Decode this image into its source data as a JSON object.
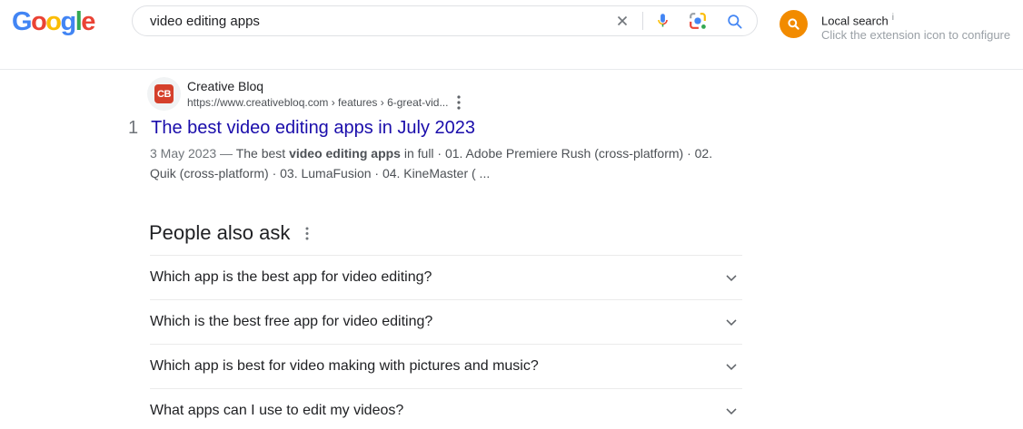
{
  "colors": {
    "google_blue": "#4285f4",
    "google_red": "#ea4335",
    "google_yellow": "#fbbc05",
    "google_green": "#34a853",
    "link_blue": "#1a0dab",
    "extension_orange": "#f28b00",
    "favicon_red": "#d5402b",
    "text_dark": "#202124",
    "text_snippet": "#4d5156",
    "text_gray": "#70757a",
    "text_light_gray": "#9aa0a6"
  },
  "header": {
    "logo_letters": [
      {
        "char": "G",
        "color": "#4285f4"
      },
      {
        "char": "o",
        "color": "#ea4335"
      },
      {
        "char": "o",
        "color": "#fbbc05"
      },
      {
        "char": "g",
        "color": "#4285f4"
      },
      {
        "char": "l",
        "color": "#34a853"
      },
      {
        "char": "e",
        "color": "#ea4335"
      }
    ],
    "search": {
      "value": "video editing apps",
      "icons": [
        "clear-x-icon",
        "mic-icon",
        "google-lens-icon",
        "search-icon"
      ]
    },
    "extension": {
      "title": "Local search",
      "info_superscript": "i",
      "subtitle": "Click the extension icon to configure",
      "icon": "orange-magnifier-icon"
    }
  },
  "result": {
    "rank": "1",
    "favicon_text": "CB",
    "site_name": "Creative Bloq",
    "breadcrumb": "https://www.creativebloq.com › features › 6-great-vid...",
    "menu_icon": "kebab-menu-icon",
    "title": "The best video editing apps in July 2023",
    "snippet_date": "3 May 2023 — ",
    "snippet_lead": "The best ",
    "snippet_bold": "video editing apps",
    "snippet_rest": " in full · 01. Adobe Premiere Rush (cross-platform) · 02. Quik (cross-platform) · 03. LumaFusion · 04. KineMaster ( ..."
  },
  "people_also_ask": {
    "heading": "People also ask",
    "menu_icon": "kebab-menu-icon",
    "expand_icon": "chevron-down-icon",
    "questions": [
      "Which app is the best app for video editing?",
      "Which is the best free app for video editing?",
      "Which app is best for video making with pictures and music?",
      "What apps can I use to edit my videos?"
    ]
  }
}
